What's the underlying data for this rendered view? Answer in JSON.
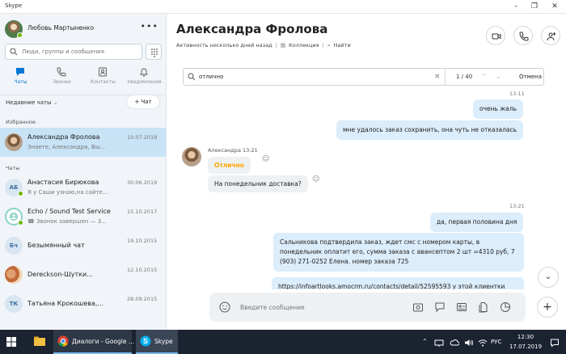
{
  "window": {
    "title": "Skype",
    "minimize": "–",
    "maximize": "❐",
    "close": "✕"
  },
  "sidebar": {
    "profile": {
      "name": "Любовь Мартыненко",
      "more": "•••"
    },
    "search": {
      "placeholder": "Люди, группы и сообщения"
    },
    "nav": [
      {
        "label": "Чаты",
        "icon": "chat-icon",
        "active": true
      },
      {
        "label": "Звонки",
        "icon": "phone-icon"
      },
      {
        "label": "Контакты",
        "icon": "contacts-icon"
      },
      {
        "label": "Уведомления",
        "icon": "bell-icon"
      }
    ],
    "recent_label": "Недавние чаты",
    "new_chat": "+ Чат",
    "favorites_label": "Избранное",
    "chats_label": "Чаты",
    "favorites": [
      {
        "name": "Александра Фролова",
        "preview": "Знаете, Александра, Вы...",
        "date": "10.07.2019",
        "selected": true
      }
    ],
    "chats": [
      {
        "name": "Анастасия Бирюкова",
        "preview": "Я у Саши узнаю,на сайте...",
        "date": "30.06.2019",
        "initials": "АБ"
      },
      {
        "name": "Echo / Sound Test Service",
        "preview": "Звонок завершен — 3...",
        "date": "15.10.2017",
        "initials": ""
      },
      {
        "name": "Безымянный чат",
        "preview": "",
        "date": "19.10.2015",
        "initials": "Бч"
      },
      {
        "name": "Dereckson-Шутки...",
        "preview": "",
        "date": "12.10.2015",
        "initials": ""
      },
      {
        "name": "Татьяна Крокошева,...",
        "preview": "",
        "date": "28.09.2015",
        "initials": "ТК"
      }
    ]
  },
  "conversation": {
    "name": "Александра Фролова",
    "status": "Активность несколько дней назад",
    "collection": "Коллекция",
    "find": "Найти",
    "find_bar": {
      "query": "отлично",
      "count": "1 / 40",
      "cancel": "Отмена"
    },
    "messages": [
      {
        "time": "13:11"
      },
      {
        "dir": "out",
        "text": "очень жаль"
      },
      {
        "dir": "out",
        "text": "мне удалось заказ сохранить, она чуть не отказалась"
      },
      {
        "sender": "Александра 13:21"
      },
      {
        "dir": "in",
        "text": "Отлично"
      },
      {
        "dir": "in",
        "text": "На понедельник доставка?"
      },
      {
        "time": "13:21"
      },
      {
        "dir": "out",
        "text": "да, первая половина дня"
      },
      {
        "dir": "out",
        "text": "Сальникова подтвердила заказ, ждет смс с номером карты, в понедельник оплатит его, сумма заказа с авансептом 2 шт =4310 руб, 7 (903) 271-0252 Елена. номер заказа 725"
      },
      {
        "dir": "out",
        "text": "https://infoartlooks.amocrm.ru/contacts/detail/52595593 у этой клиентки"
      }
    ],
    "composer_placeholder": "Введите сообщение"
  },
  "taskbar": {
    "apps": [
      {
        "label": "Диалоги - Google ...",
        "icon": "chrome-icon"
      },
      {
        "label": "Skype",
        "icon": "skype-icon"
      }
    ],
    "lang": "РУС",
    "time": "12:30",
    "date": "17.07.2019"
  },
  "colors": {
    "accent": "#0078d4",
    "selected": "#c8e3f6",
    "bubble_out": "#dcedfb",
    "highlight": "#ffa500",
    "online": "#6bb700"
  }
}
